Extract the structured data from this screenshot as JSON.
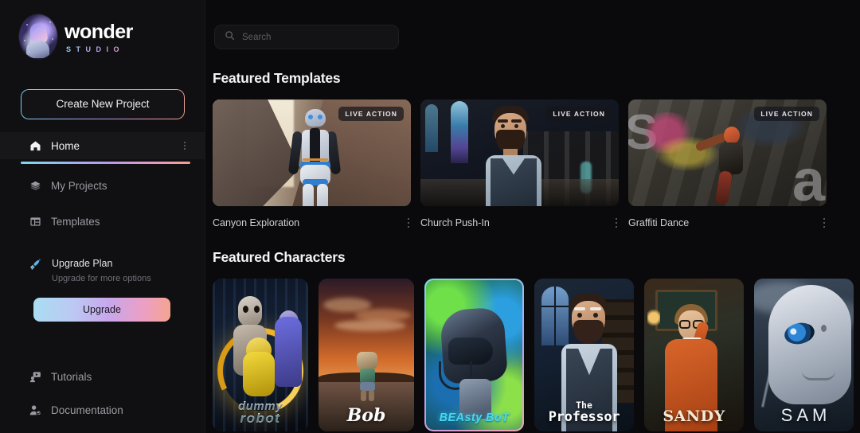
{
  "brand": {
    "name": "wonder",
    "tagline": "STUDIO",
    "logo_icon": "wonder-avatar-icon"
  },
  "sidebar": {
    "create_button": "Create New Project",
    "items": [
      {
        "label": "Home",
        "icon": "home-icon",
        "active": true
      },
      {
        "label": "My Projects",
        "icon": "layers-icon",
        "active": false
      },
      {
        "label": "Templates",
        "icon": "templates-grid-icon",
        "active": false
      }
    ],
    "upgrade": {
      "icon": "rocket-icon",
      "title": "Upgrade Plan",
      "subtitle": "Upgrade for more options",
      "button": "Upgrade"
    },
    "bottom_items": [
      {
        "label": "Tutorials",
        "icon": "tutorial-video-icon"
      },
      {
        "label": "Documentation",
        "icon": "person-doc-icon"
      }
    ]
  },
  "search": {
    "placeholder": "Search",
    "value": "",
    "icon": "search-icon"
  },
  "sections": {
    "templates_title": "Featured Templates",
    "characters_title": "Featured Characters"
  },
  "templates": [
    {
      "name": "Canyon Exploration",
      "badge": "LIVE ACTION",
      "art": "canyon"
    },
    {
      "name": "Church Push-In",
      "badge": "LIVE ACTION",
      "art": "church"
    },
    {
      "name": "Graffiti Dance",
      "badge": "LIVE ACTION",
      "art": "graffiti"
    }
  ],
  "characters": [
    {
      "name_line1": "dummy",
      "name_line2": "robot",
      "selected": false
    },
    {
      "name": "Bob",
      "selected": false
    },
    {
      "name": "BEAsty BoT",
      "selected": true
    },
    {
      "name_line1": "The",
      "name_line2": "Professor",
      "selected": false
    },
    {
      "name": "SANDY",
      "selected": false
    },
    {
      "name": "SAM",
      "selected": false
    }
  ],
  "colors": {
    "background": "#0a0a0c",
    "sidebar": "#101012",
    "accent_gradient_start": "#7fd8ef",
    "accent_gradient_mid": "#b79ae8",
    "accent_gradient_end": "#f3a08e",
    "text_primary": "#f2f2f4",
    "text_muted": "#9a9aa2"
  }
}
